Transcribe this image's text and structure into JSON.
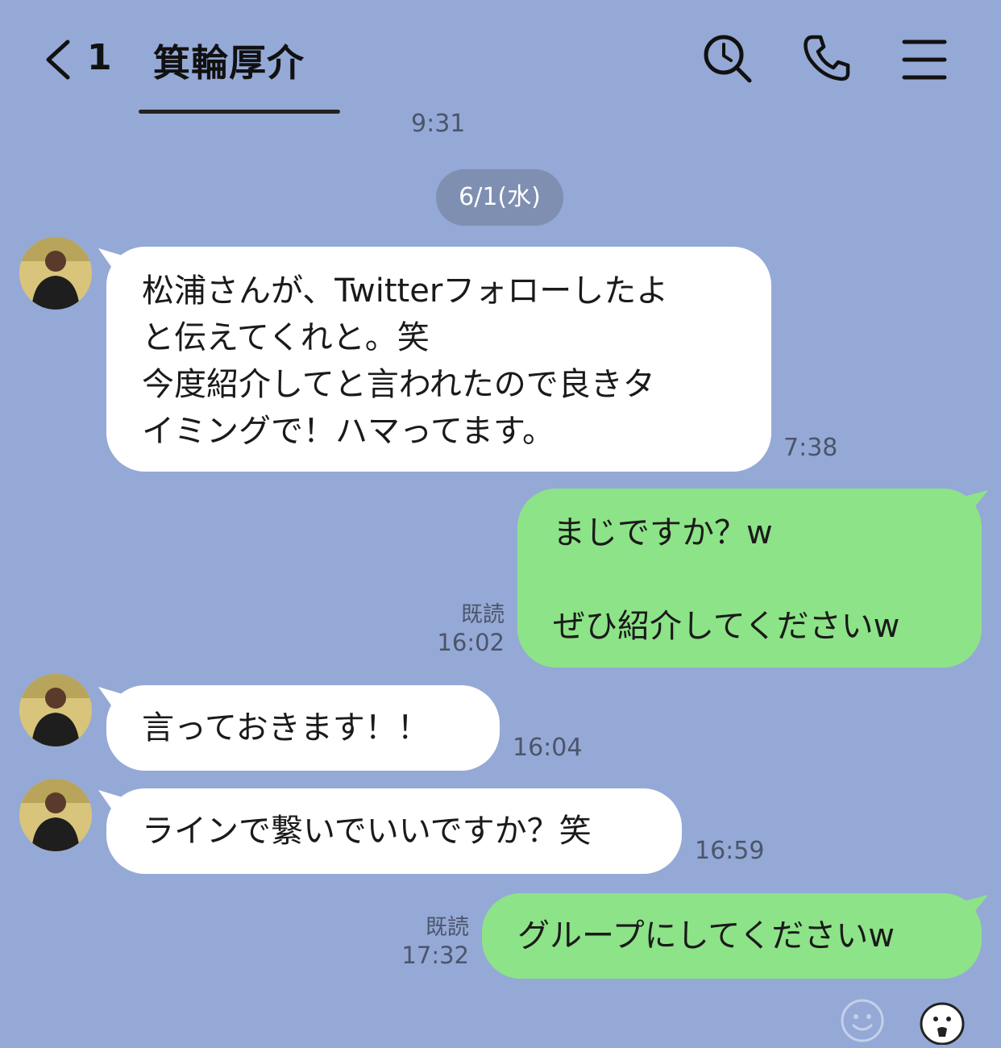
{
  "header": {
    "unread_count": "1",
    "title": "箕輪厚介",
    "icons": [
      "back-icon",
      "search-icon",
      "phone-icon",
      "menu-icon"
    ]
  },
  "top_time": "9:31",
  "date_divider": "6/1(水)",
  "messages": [
    {
      "side": "incoming",
      "text": "松浦さんが、Twitterフォローしたよ\nと伝えてくれと。笑\n今度紹介してと言われたので良きタ\nイミングで！ハマってます。",
      "time": "7:38"
    },
    {
      "side": "outgoing",
      "text": "まじですか？w\n\nぜひ紹介してくださいw",
      "read": "既読",
      "time": "16:02"
    },
    {
      "side": "incoming",
      "text": "言っておきます！！",
      "time": "16:04"
    },
    {
      "side": "incoming",
      "text": "ラインで繋いでいいですか？笑",
      "time": "16:59"
    },
    {
      "side": "outgoing",
      "text": "グループにしてくださいw",
      "read": "既読",
      "time": "17:32"
    }
  ],
  "bottom_icons": [
    "smiley-icon",
    "sticker-icon"
  ],
  "colors": {
    "background": "#95a9d6",
    "incoming_bubble": "#ffffff",
    "outgoing_bubble": "#8de387",
    "date_pill": "#7f8fb2",
    "meta_text": "#4b556b"
  }
}
